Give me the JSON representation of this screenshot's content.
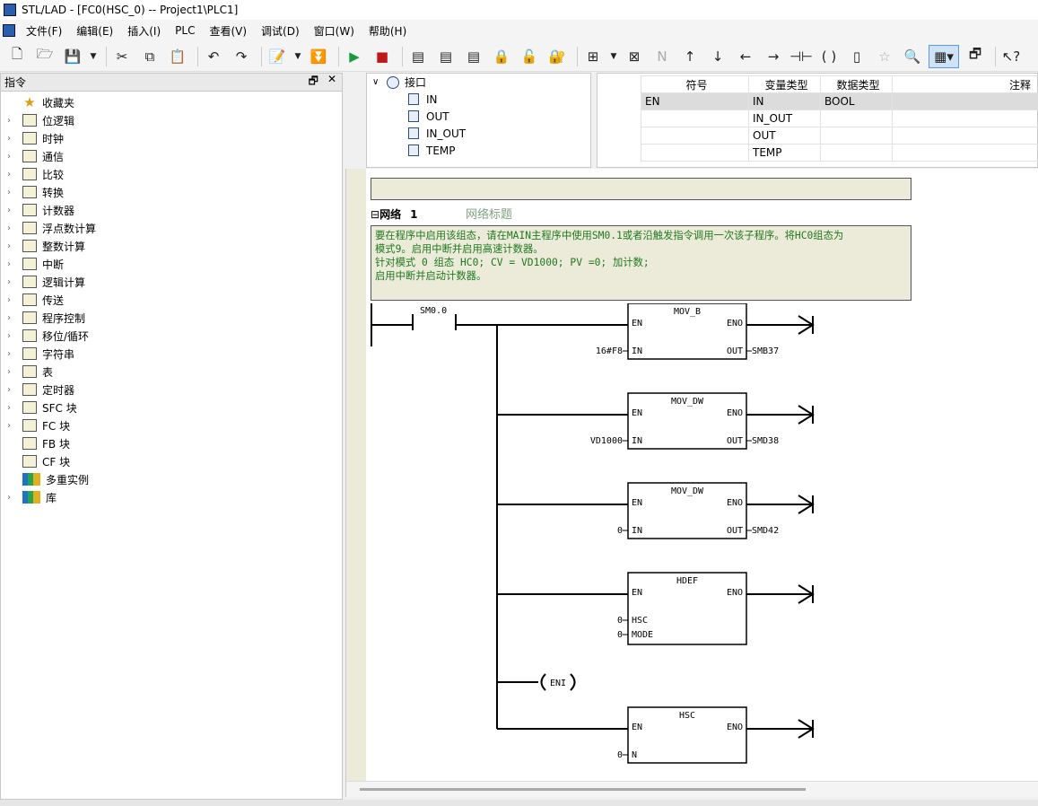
{
  "window": {
    "title": "STL/LAD - [FC0(HSC_0) -- Project1\\PLC1]"
  },
  "menu": [
    "文件(F)",
    "编辑(E)",
    "插入(I)",
    "PLC",
    "查看(V)",
    "调试(D)",
    "窗口(W)",
    "帮助(H)"
  ],
  "left_panel": {
    "title": "指令",
    "items": [
      {
        "label": "收藏夹",
        "icon": "star-icon",
        "expandable": false
      },
      {
        "label": "位逻辑",
        "icon": "bit-logic-icon",
        "expandable": true
      },
      {
        "label": "时钟",
        "icon": "clock-icon",
        "expandable": true
      },
      {
        "label": "通信",
        "icon": "communication-icon",
        "expandable": true
      },
      {
        "label": "比较",
        "icon": "compare-icon",
        "expandable": true
      },
      {
        "label": "转换",
        "icon": "convert-icon",
        "expandable": true
      },
      {
        "label": "计数器",
        "icon": "counter-icon",
        "expandable": true
      },
      {
        "label": "浮点数计算",
        "icon": "float-math-icon",
        "expandable": true
      },
      {
        "label": "整数计算",
        "icon": "integer-math-icon",
        "expandable": true
      },
      {
        "label": "中断",
        "icon": "interrupt-icon",
        "expandable": true
      },
      {
        "label": "逻辑计算",
        "icon": "logic-math-icon",
        "expandable": true
      },
      {
        "label": "传送",
        "icon": "move-icon",
        "expandable": true
      },
      {
        "label": "程序控制",
        "icon": "program-control-icon",
        "expandable": true
      },
      {
        "label": "移位/循环",
        "icon": "shift-rotate-icon",
        "expandable": true
      },
      {
        "label": "字符串",
        "icon": "string-icon",
        "expandable": true
      },
      {
        "label": "表",
        "icon": "table-icon",
        "expandable": true
      },
      {
        "label": "定时器",
        "icon": "timer-icon",
        "expandable": true
      },
      {
        "label": "SFC 块",
        "icon": "sfc-block-icon",
        "expandable": true
      },
      {
        "label": "FC 块",
        "icon": "fc-block-icon",
        "expandable": true
      },
      {
        "label": "FB 块",
        "icon": "fb-block-icon",
        "expandable": false
      },
      {
        "label": "CF 块",
        "icon": "cf-block-icon",
        "expandable": false
      },
      {
        "label": "多重实例",
        "icon": "multi-instance-icon",
        "expandable": false
      },
      {
        "label": "库",
        "icon": "library-icon",
        "expandable": true
      }
    ]
  },
  "interface": {
    "root": "接口",
    "children": [
      "IN",
      "OUT",
      "IN_OUT",
      "TEMP"
    ]
  },
  "var_table": {
    "headers": [
      "符号",
      "变量类型",
      "数据类型",
      "注释"
    ],
    "rows": [
      {
        "symbol": "EN",
        "var_type": "IN",
        "data_type": "BOOL",
        "comment": ""
      },
      {
        "symbol": "",
        "var_type": "IN_OUT",
        "data_type": "",
        "comment": ""
      },
      {
        "symbol": "",
        "var_type": "OUT",
        "data_type": "",
        "comment": ""
      },
      {
        "symbol": "",
        "var_type": "TEMP",
        "data_type": "",
        "comment": ""
      }
    ]
  },
  "network": {
    "label": "网络",
    "number": "1",
    "title_placeholder": "网络标题",
    "comment_lines": [
      "要在程序中启用该组态，请在MAIN主程序中使用SM0.1或者沿触发指令调用一次该子程序。将HC0组态为",
      "模式9。启用中断并启用高速计数器。",
      "针对模式 0 组态 HC0;  CV = VD1000;  PV =0;  加计数;",
      "启用中断并启动计数器。"
    ],
    "contact": "SM0.0",
    "blocks": [
      {
        "name": "MOV_B",
        "in_pins": [
          {
            "pin": "IN",
            "value": "16#F8"
          }
        ],
        "out_pins": [
          {
            "pin": "OUT",
            "value": "SMB37"
          }
        ]
      },
      {
        "name": "MOV_DW",
        "in_pins": [
          {
            "pin": "IN",
            "value": "VD1000"
          }
        ],
        "out_pins": [
          {
            "pin": "OUT",
            "value": "SMD38"
          }
        ]
      },
      {
        "name": "MOV_DW",
        "in_pins": [
          {
            "pin": "IN",
            "value": "0"
          }
        ],
        "out_pins": [
          {
            "pin": "OUT",
            "value": "SMD42"
          }
        ]
      },
      {
        "name": "HDEF",
        "in_pins": [
          {
            "pin": "HSC",
            "value": "0"
          },
          {
            "pin": "MODE",
            "value": "0"
          }
        ],
        "out_pins": []
      },
      {
        "name": "HSC",
        "in_pins": [
          {
            "pin": "N",
            "value": "0"
          }
        ],
        "out_pins": []
      }
    ],
    "coil": "ENI",
    "en_label": "EN",
    "eno_label": "ENO"
  }
}
